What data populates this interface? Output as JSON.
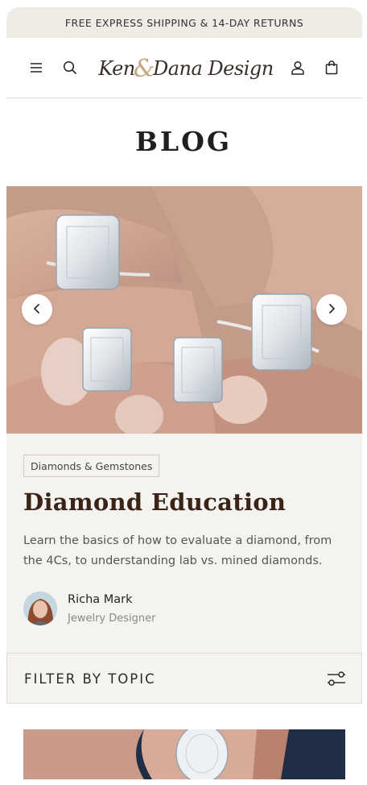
{
  "announcement": {
    "text": "FREE EXPRESS SHIPPING & 14-DAY RETURNS"
  },
  "header": {
    "logo": {
      "part1": "Ken",
      "amp": "&",
      "part2": "Dana Design"
    },
    "icons": {
      "menu": "menu-icon",
      "search": "search-icon",
      "account": "account-icon",
      "bag": "shopping-bag-icon"
    }
  },
  "page_title": "BLOG",
  "hero": {
    "image": "diamond-rings-on-hand",
    "prev_icon": "chevron-left-icon",
    "next_icon": "chevron-right-icon"
  },
  "featured_post": {
    "tag": "Diamonds & Gemstones",
    "title": "Diamond Education",
    "excerpt": "Learn the basics of how to evaluate a diamond, from the 4Cs, to understanding lab vs. mined diamonds.",
    "author": {
      "name": "Richa Mark",
      "role": "Jewelry Designer"
    }
  },
  "filter": {
    "label": "FILTER BY TOPIC",
    "icon": "sliders-icon"
  },
  "colors": {
    "announcement_bg": "#efebe5",
    "card_bg": "#f5f3f0",
    "title_brown": "#3b2417",
    "logo_gold": "#c7a780"
  }
}
